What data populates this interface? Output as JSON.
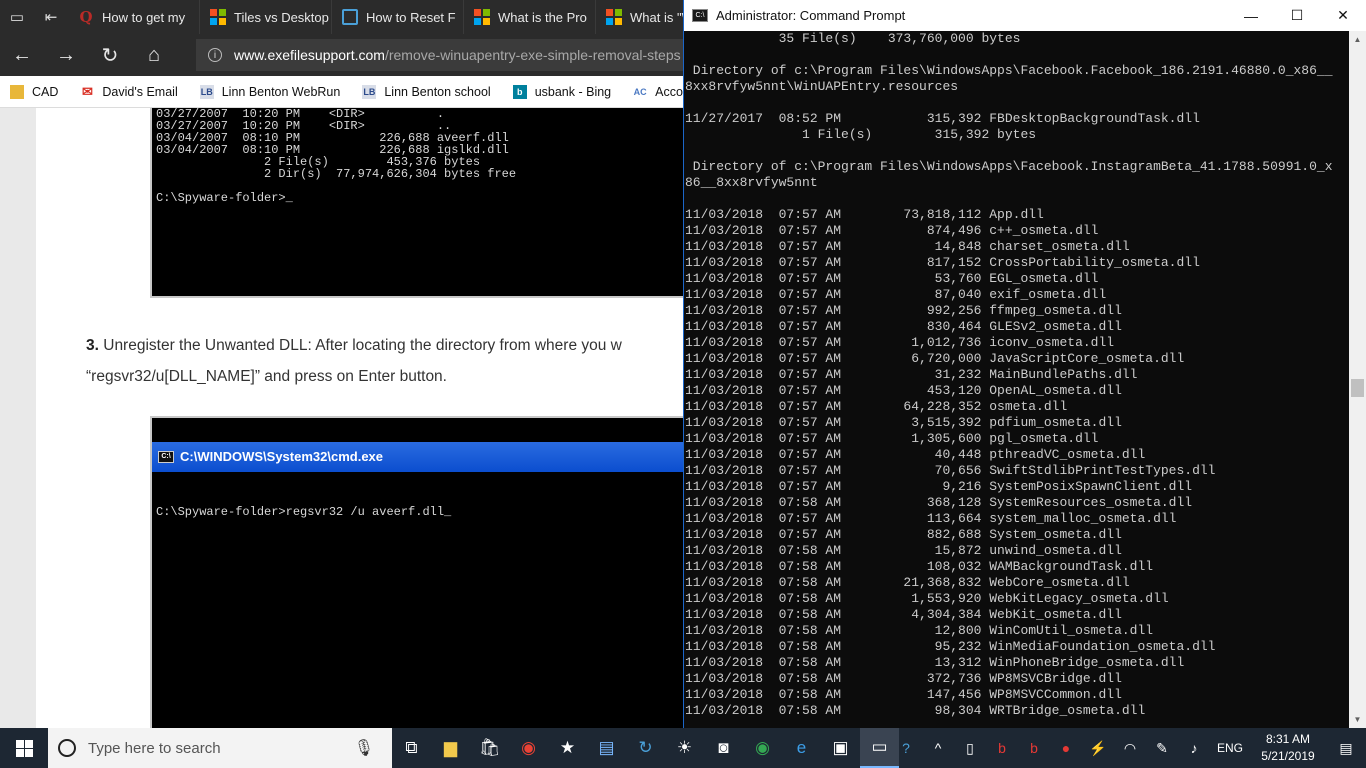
{
  "browser": {
    "tabs": [
      {
        "label": "How to get my",
        "icon": "quora-icon"
      },
      {
        "label": "Tiles vs Desktop",
        "icon": "microsoft-icon"
      },
      {
        "label": "How to Reset F",
        "icon": "ie-icon"
      },
      {
        "label": "What is the Pro",
        "icon": "microsoft-icon"
      },
      {
        "label": "What is \"W",
        "icon": "microsoft-icon"
      }
    ],
    "address": {
      "host": "www.exefilesupport.com",
      "path": "/remove-winuapentry-exe-simple-removal-steps"
    },
    "favorites": [
      {
        "label": "CAD",
        "icon": "folder-icon"
      },
      {
        "label": "David's Email",
        "icon": "gmail-icon"
      },
      {
        "label": "Linn Benton WebRun",
        "icon": "lb-icon"
      },
      {
        "label": "Linn Benton school",
        "icon": "lb-icon"
      },
      {
        "label": "usbank - Bing",
        "icon": "bing-icon"
      },
      {
        "label": "Accounting Coac",
        "icon": "ac-icon"
      }
    ]
  },
  "article": {
    "term_top_lines": [
      "03/27/2007  10:20 PM    <DIR>          .",
      "03/27/2007  10:20 PM    <DIR>          ..",
      "03/04/2007  08:10 PM           226,688 aveerf.dll",
      "03/04/2007  08:10 PM           226,688 igslkd.dll",
      "               2 File(s)        453,376 bytes",
      "               2 Dir(s)  77,974,626,304 bytes free",
      "",
      "C:\\Spyware-folder>_"
    ],
    "step_number": "3.",
    "step_text": " Unregister the Unwanted DLL: After locating the directory from where you w",
    "step_text_2": "“regsvr32/u[DLL_NAME]” and press on Enter button.",
    "term_bottom_title": "C:\\WINDOWS\\System32\\cmd.exe",
    "term_bottom_line": "C:\\Spyware-folder>regsvr32 /u aveerf.dll_"
  },
  "cmd": {
    "title": "Administrator: Command Prompt",
    "lines": [
      "            35 File(s)    373,760,000 bytes",
      "",
      " Directory of c:\\Program Files\\WindowsApps\\Facebook.Facebook_186.2191.46880.0_x86__",
      "8xx8rvfyw5nnt\\WinUAPEntry.resources",
      "",
      "11/27/2017  08:52 PM           315,392 FBDesktopBackgroundTask.dll",
      "               1 File(s)        315,392 bytes",
      "",
      " Directory of c:\\Program Files\\WindowsApps\\Facebook.InstagramBeta_41.1788.50991.0_x",
      "86__8xx8rvfyw5nnt",
      "",
      "11/03/2018  07:57 AM        73,818,112 App.dll",
      "11/03/2018  07:57 AM           874,496 c++_osmeta.dll",
      "11/03/2018  07:57 AM            14,848 charset_osmeta.dll",
      "11/03/2018  07:57 AM           817,152 CrossPortability_osmeta.dll",
      "11/03/2018  07:57 AM            53,760 EGL_osmeta.dll",
      "11/03/2018  07:57 AM            87,040 exif_osmeta.dll",
      "11/03/2018  07:57 AM           992,256 ffmpeg_osmeta.dll",
      "11/03/2018  07:57 AM           830,464 GLESv2_osmeta.dll",
      "11/03/2018  07:57 AM         1,012,736 iconv_osmeta.dll",
      "11/03/2018  07:57 AM         6,720,000 JavaScriptCore_osmeta.dll",
      "11/03/2018  07:57 AM            31,232 MainBundlePaths.dll",
      "11/03/2018  07:57 AM           453,120 OpenAL_osmeta.dll",
      "11/03/2018  07:57 AM        64,228,352 osmeta.dll",
      "11/03/2018  07:57 AM         3,515,392 pdfium_osmeta.dll",
      "11/03/2018  07:57 AM         1,305,600 pgl_osmeta.dll",
      "11/03/2018  07:57 AM            40,448 pthreadVC_osmeta.dll",
      "11/03/2018  07:57 AM            70,656 SwiftStdlibPrintTestTypes.dll",
      "11/03/2018  07:57 AM             9,216 SystemPosixSpawnClient.dll",
      "11/03/2018  07:58 AM           368,128 SystemResources_osmeta.dll",
      "11/03/2018  07:57 AM           113,664 system_malloc_osmeta.dll",
      "11/03/2018  07:57 AM           882,688 System_osmeta.dll",
      "11/03/2018  07:58 AM            15,872 unwind_osmeta.dll",
      "11/03/2018  07:58 AM           108,032 WAMBackgroundTask.dll",
      "11/03/2018  07:58 AM        21,368,832 WebCore_osmeta.dll",
      "11/03/2018  07:58 AM         1,553,920 WebKitLegacy_osmeta.dll",
      "11/03/2018  07:58 AM         4,304,384 WebKit_osmeta.dll",
      "11/03/2018  07:58 AM            12,800 WinComUtil_osmeta.dll",
      "11/03/2018  07:58 AM            95,232 WinMediaFoundation_osmeta.dll",
      "11/03/2018  07:58 AM            13,312 WinPhoneBridge_osmeta.dll",
      "11/03/2018  07:58 AM           372,736 WP8MSVCBridge.dll",
      "11/03/2018  07:58 AM           147,456 WP8MSVCCommon.dll",
      "11/03/2018  07:58 AM            98,304 WRTBridge_osmeta.dll"
    ]
  },
  "taskbar": {
    "search_placeholder": "Type here to search",
    "language": "ENG",
    "time": "8:31 AM",
    "date": "5/21/2019"
  }
}
